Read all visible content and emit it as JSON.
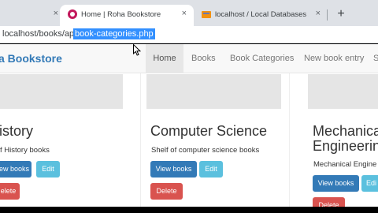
{
  "browser": {
    "tabs": [
      {
        "title": "",
        "icon": "tab-partial-icon"
      },
      {
        "title": "Home | Roha Bookstore",
        "icon": "roha-favicon-icon",
        "active": true
      },
      {
        "title": "localhost / Local Databases / bo",
        "icon": "phpmyadmin-favicon-icon"
      }
    ],
    "close_glyph": "×",
    "new_tab_glyph": "+",
    "address": {
      "prefix": "localhost/books/app/",
      "selected": "book-categories.php"
    }
  },
  "navbar": {
    "brand": "a Bookstore",
    "items": [
      "Home",
      "Books",
      "Book Categories",
      "New book entry",
      "S"
    ],
    "active_index": 0
  },
  "categories": [
    {
      "name": "istory",
      "description": "f History books",
      "view_label": "ew books",
      "edit_label": "Edit",
      "delete_label": "elete"
    },
    {
      "name": "Computer Science",
      "description": "Shelf of computer science books",
      "view_label": "View books",
      "edit_label": "Edit",
      "delete_label": "Delete"
    },
    {
      "name_line1": "Mechanica",
      "name_line2": "Engineering",
      "description": "Mechanical Engine",
      "view_label": "View books",
      "edit_label": "Edi",
      "delete_label": "Delete"
    }
  ],
  "colors": {
    "primary": "#337ab7",
    "info": "#5bc0de",
    "danger": "#d9534f",
    "selection": "#3390ff"
  }
}
